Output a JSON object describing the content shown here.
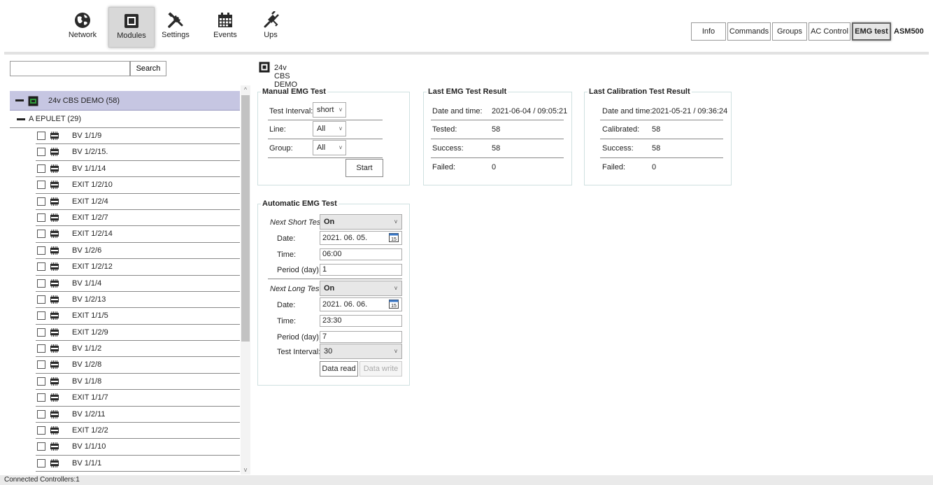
{
  "toolbar": {
    "nav": [
      {
        "label": "Network"
      },
      {
        "label": "Modules"
      },
      {
        "label": "Settings"
      },
      {
        "label": "Events"
      },
      {
        "label": "Ups"
      }
    ],
    "active_nav": "Modules",
    "tabs": [
      {
        "label": "Info"
      },
      {
        "label": "Commands"
      },
      {
        "label": "Groups"
      },
      {
        "label": "AC Control"
      },
      {
        "label": "EMG test"
      }
    ],
    "active_tab": "EMG test",
    "app_name": "ASM500"
  },
  "search": {
    "value": "",
    "button": "Search"
  },
  "tree": {
    "root": "24v CBS DEMO (58)",
    "group": "A EPULET (29)",
    "items": [
      "BV 1/1/9",
      "BV 1/2/15.",
      "BV 1/1/14",
      "EXIT 1/2/10",
      "EXIT 1/2/4",
      "EXIT 1/2/7",
      "EXIT 1/2/14",
      "BV 1/2/6",
      "EXIT 1/2/12",
      "BV 1/1/4",
      "BV 1/2/13",
      "EXIT 1/1/5",
      "EXIT 1/2/9",
      "BV 1/1/2",
      "BV 1/2/8",
      "BV 1/1/8",
      "EXIT 1/1/7",
      "BV 1/2/11",
      "EXIT 1/2/2",
      "BV 1/1/10",
      "BV 1/1/1"
    ]
  },
  "content": {
    "module_title": "24v CBS DEMO",
    "manual": {
      "title": "Manual EMG Test",
      "test_interval_label": "Test Interval:",
      "test_interval_value": "short",
      "line_label": "Line:",
      "line_value": "All",
      "group_label": "Group:",
      "group_value": "All",
      "start_button": "Start"
    },
    "last_result": {
      "title": "Last EMG Test Result",
      "date_label": "Date and time:",
      "date_value": "2021-06-04 / 09:05:21",
      "tested_label": "Tested:",
      "tested_value": "58",
      "success_label": "Success:",
      "success_value": "58",
      "failed_label": "Failed:",
      "failed_value": "0"
    },
    "calibration": {
      "title": "Last Calibration Test Result",
      "date_label": "Date and time:",
      "date_value": "2021-05-21 / 09:36:24",
      "calibrated_label": "Calibrated:",
      "calibrated_value": "58",
      "success_label": "Success:",
      "success_value": "58",
      "failed_label": "Failed:",
      "failed_value": "0"
    },
    "automatic": {
      "title": "Automatic EMG Test",
      "short_label": "Next Short Test",
      "short_value": "On",
      "short_date_label": "Date:",
      "short_date_value": "2021. 06. 05.",
      "short_time_label": "Time:",
      "short_time_value": "06:00",
      "short_period_label": "Period (day):",
      "short_period_value": "1",
      "long_label": "Next Long Test",
      "long_value": "On",
      "long_date_label": "Date:",
      "long_date_value": "2021. 06. 06.",
      "long_time_label": "Time:",
      "long_time_value": "23:30",
      "long_period_label": "Period (day):",
      "long_period_value": "7",
      "interval_label": "Test Interval:",
      "interval_value": "30",
      "read_button": "Data read",
      "write_button": "Data write"
    }
  },
  "status": "Connected Controllers:1"
}
